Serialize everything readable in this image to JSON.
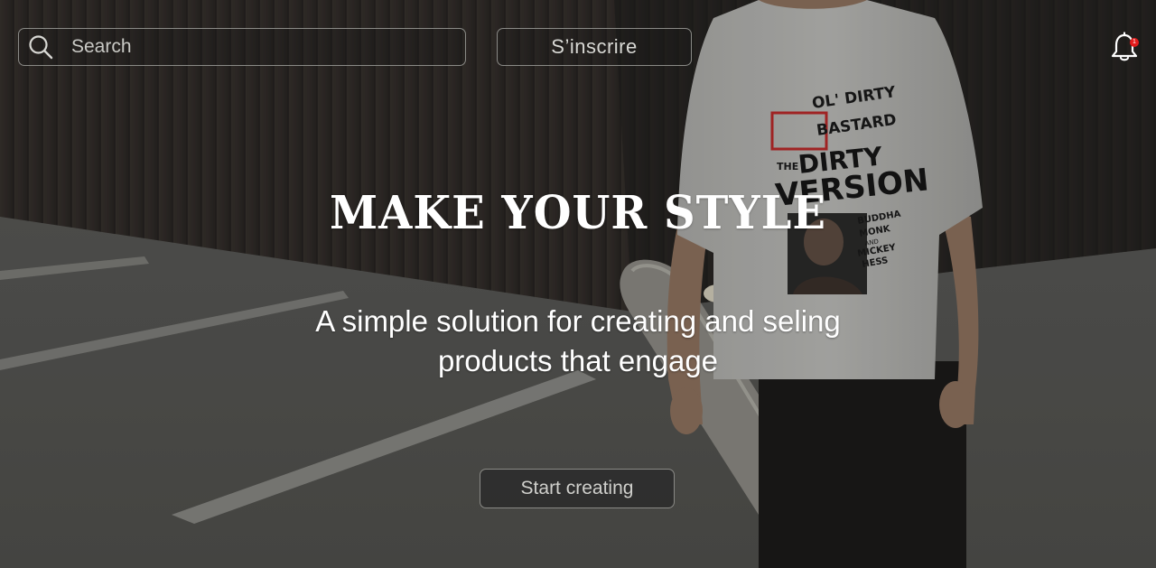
{
  "header": {
    "search_placeholder": "Search",
    "signup_label": "S’inscrire",
    "notification_count": "1"
  },
  "hero": {
    "headline": "MAKE YOUR STYLE",
    "subtitle_line1": "A simple solution for creating and seling",
    "subtitle_line2": "products that engage",
    "cta_label": "Start creating"
  },
  "shirt_print": {
    "line1": "OL' DIRTY",
    "line2": "BASTARD",
    "line3": "THE",
    "line4": "DIRTY",
    "line5": "VERSION",
    "line6": "BUDDHA",
    "line7": "MONK",
    "line8": "AND",
    "line9": "MICKEY",
    "line10": "HESS"
  },
  "colors": {
    "badge": "#e21b1b",
    "border": "#8a8a86",
    "text": "#ffffff"
  }
}
